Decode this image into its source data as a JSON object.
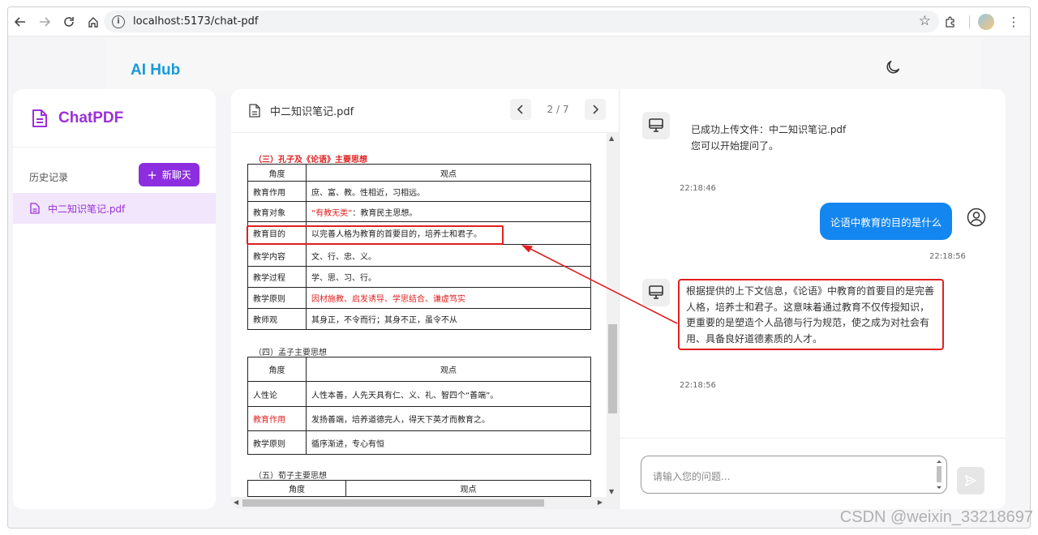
{
  "browser": {
    "url": "localhost:5173/chat-pdf"
  },
  "header": {
    "brand": "AI Hub"
  },
  "sidebar": {
    "title": "ChatPDF",
    "history_label": "历史记录",
    "new_chat_label": "新聊天",
    "items": [
      {
        "label": "中二知识笔记.pdf"
      }
    ]
  },
  "pdf": {
    "filename": "中二知识笔记.pdf",
    "page_indicator": "2 / 7",
    "section3": {
      "title": "（三）孔子及《论语》主要思想",
      "headers": [
        "角度",
        "观点"
      ],
      "rows": [
        {
          "k": "教育作用",
          "v": "庶、富、教。性相近，习相远。"
        },
        {
          "k": "教育对象",
          "v_red": "“有教无类”",
          "v": "：教育民主思想。"
        },
        {
          "k": "教育目的",
          "v": "以完善人格为教育的首要目的，培养士和君子。"
        },
        {
          "k": "教学内容",
          "v": "文、行、忠、义。"
        },
        {
          "k": "教学过程",
          "v": "学、思、习、行。"
        },
        {
          "k": "教学原则",
          "v": "因材施教、启发诱导、学思结合、谦虚笃实"
        },
        {
          "k": "教师观",
          "v": "其身正，不令而行；其身不正，虽令不从"
        }
      ]
    },
    "section4": {
      "title": "（四）孟子主要思想",
      "headers": [
        "角度",
        "观点"
      ],
      "rows": [
        {
          "k": "人性论",
          "v": "人性本善，人先天具有仁、义、礼、智四个“善端”。"
        },
        {
          "k": "教育作用",
          "v": "发扬善端，培养道德完人，得天下英才而教育之。"
        },
        {
          "k": "教学原则",
          "v": "循序渐进，专心有恒"
        }
      ]
    },
    "section5": {
      "title": "（五）荀子主要思想",
      "headers": [
        "角度",
        "观点"
      ]
    }
  },
  "chat": {
    "messages": [
      {
        "role": "bot",
        "lines": [
          "已成功上传文件：中二知识笔记.pdf",
          "您可以开始提问了。"
        ],
        "time": "22:18:46"
      },
      {
        "role": "user",
        "text": "论语中教育的目的是什么",
        "time": "22:18:56"
      },
      {
        "role": "bot",
        "text": "根据提供的上下文信息，《论语》中教育的首要目的是完善人格，培养士和君子。这意味着通过教育不仅传授知识，更重要的是塑造个人品德与行为规范，使之成为对社会有用、具备良好道德素质的人才。",
        "time": "22:18:56"
      }
    ],
    "input_placeholder": "请输入您的问题..."
  },
  "watermark": "CSDN @weixin_33218697",
  "colors": {
    "brand_blue": "#1a9ad8",
    "accent_purple": "#8c2ee0",
    "user_bubble": "#1386f0",
    "highlight_red": "#e02020"
  }
}
